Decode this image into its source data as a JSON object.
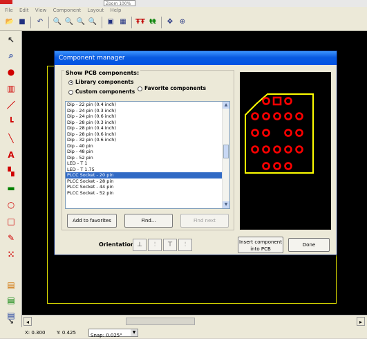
{
  "titlebar": {
    "zoom_value": "Zoom 100%"
  },
  "menu": [
    "File",
    "Edit",
    "View",
    "Component",
    "Layout",
    "Help"
  ],
  "toolbar_icons": [
    "open-icon",
    "save-icon",
    "undo-icon",
    "zoom-in-icon",
    "zoom-out-icon",
    "zoom-fit-icon",
    "zoom-area-icon",
    "properties-icon",
    "grid-icon",
    "mirror-icon",
    "align-icon",
    "move-icon",
    "center-icon"
  ],
  "palette_icons": [
    "select-arrow-icon",
    "zoom-tool-icon",
    "pad-icon",
    "component-icon",
    "track-icon",
    "angled-track-icon",
    "diagonal-track-icon",
    "text-icon",
    "smd-pad-icon",
    "connector-icon",
    "circle-icon",
    "rectangle-icon",
    "polygon-icon",
    "via-icon",
    "layer1-icon",
    "layer2-icon",
    "layer3-icon",
    "pointer-icon"
  ],
  "dialog": {
    "title": "Component manager",
    "group_label": "Show PCB components:",
    "radio_library": "Library components",
    "radio_custom": "Custom components",
    "radio_favorite": "Favorite components",
    "selected_radio": "library",
    "components": [
      "Dip - 22 pin (0.4 inch)",
      "Dip - 24 pin (0.3 inch)",
      "Dip - 24 pin (0.6 inch)",
      "Dip - 28 pin (0.3 inch)",
      "Dip - 28 pin (0.4 inch)",
      "Dip - 28 pin (0.6 inch)",
      "Dip - 32 pin (0.6 inch)",
      "Dip - 40 pin",
      "Dip - 48 pin",
      "Dip - 52 pin",
      "LED - T 1",
      "LED - T 1.75",
      "PLCC Socket - 20 pin",
      "PLCC Socket - 28 pin",
      "PLCC Socket - 44 pin",
      "PLCC Socket - 52 pin"
    ],
    "selected_index": 12,
    "btn_add_favorites": "Add to favorites",
    "btn_find": "Find...",
    "btn_find_next": "Find next",
    "orientation_label": "Orientation:",
    "btn_insert": "Insert component into PCB",
    "btn_done": "Done",
    "preview": {
      "outline_color": "#ffff00",
      "pad_color": "#ff0000"
    }
  },
  "status": {
    "x": "X: 0.300",
    "y": "Y: 0.425",
    "snap": "Snap: 0.025\""
  }
}
